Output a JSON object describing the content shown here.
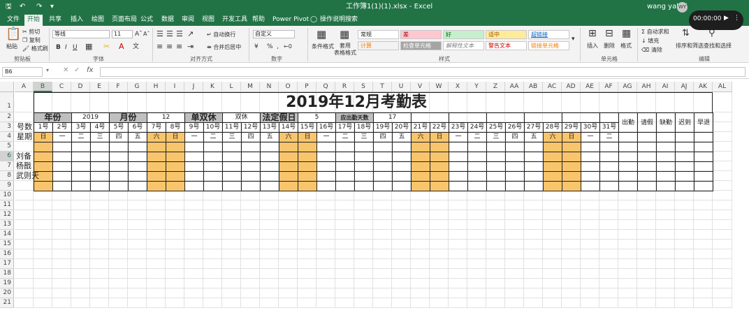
{
  "window": {
    "title": "工作簿1(1)(1).xlsx  -  Excel",
    "user": "wang yahui",
    "user_initials": "WY",
    "timer": "00:00:00"
  },
  "tabs": [
    "文件",
    "开始",
    "共享",
    "插入",
    "绘图",
    "页面布局",
    "公式",
    "数据",
    "审阅",
    "视图",
    "开发工具",
    "帮助",
    "Power Pivot",
    "操作说明搜索"
  ],
  "ribbon": {
    "clipboard": {
      "paste": "粘贴",
      "cut": "剪切",
      "copy": "复制",
      "format_painter": "格式刷",
      "group": "剪贴板"
    },
    "font": {
      "name": "等线",
      "size": "11",
      "group": "字体"
    },
    "alignment": {
      "wrap": "自动换行",
      "merge": "合并后居中",
      "group": "对齐方式"
    },
    "number": {
      "format": "自定义",
      "group": "数字"
    },
    "styles": {
      "conditional": "条件格式",
      "table": "套用\n表格格式",
      "cells": [
        "常规",
        "差",
        "好",
        "适中",
        "超链接",
        "计算",
        "检查单元格",
        "解释性文本",
        "警告文本",
        "链接单元格"
      ],
      "group": "样式"
    },
    "cells_grp": {
      "insert": "插入",
      "delete": "删除",
      "format": "格式",
      "group": "单元格"
    },
    "editing": {
      "autosum": "自动求和",
      "fill": "填充",
      "clear": "清除",
      "sort": "排序和筛选",
      "find": "查找和选择",
      "group": "编辑"
    }
  },
  "formula": {
    "name_box": "B6",
    "formula": ""
  },
  "columns": [
    "A",
    "B",
    "C",
    "D",
    "E",
    "F",
    "G",
    "H",
    "I",
    "J",
    "K",
    "L",
    "M",
    "N",
    "O",
    "P",
    "Q",
    "R",
    "S",
    "T",
    "U",
    "V",
    "W",
    "X",
    "Y",
    "Z",
    "AA",
    "AB",
    "AC",
    "AD",
    "AE",
    "AF",
    "AG",
    "AH",
    "AI",
    "AJ",
    "AK",
    "AL"
  ],
  "rows": [
    "1",
    "2",
    "3",
    "4",
    "5",
    "6",
    "7",
    "8",
    "9",
    "10",
    "11",
    "12",
    "13",
    "14",
    "15",
    "16",
    "17",
    "18",
    "19",
    "20",
    "21"
  ],
  "sheet": {
    "title": "2019年12月考勤表",
    "row2": {
      "year_label": "年份",
      "year": "2019",
      "month_label": "月份",
      "month": "12",
      "weekend_label": "单双休",
      "weekend": "双休",
      "holiday_label": "法定假日",
      "holiday": "5",
      "required_label": "应出勤天数",
      "required": "17"
    },
    "header_label": "号数",
    "weekday_label": "星期",
    "days": [
      "1号",
      "2号",
      "3号",
      "4号",
      "5号",
      "6号",
      "7号",
      "8号",
      "9号",
      "10号",
      "11号",
      "12号",
      "13号",
      "14号",
      "15号",
      "16号",
      "17号",
      "18号",
      "19号",
      "20号",
      "21号",
      "22号",
      "23号",
      "24号",
      "25号",
      "26号",
      "27号",
      "28号",
      "29号",
      "30号",
      "31号"
    ],
    "weekdays": [
      "日",
      "一",
      "二",
      "三",
      "四",
      "五",
      "六",
      "日",
      "一",
      "二",
      "三",
      "四",
      "五",
      "六",
      "日",
      "一",
      "二",
      "三",
      "四",
      "五",
      "六",
      "日",
      "一",
      "二",
      "三",
      "四",
      "五",
      "六",
      "日",
      "一",
      "二"
    ],
    "summary": [
      "出勤\n天数",
      "请假\n天数",
      "缺勤\n天数",
      "迟到\n天数",
      "早退\n天数"
    ],
    "names": [
      "刘备",
      "杨戬",
      "武则天"
    ]
  },
  "colors": {
    "excel_green": "#217346",
    "weekend": "#f9c56c",
    "label_bg": "#bfbfbf"
  }
}
